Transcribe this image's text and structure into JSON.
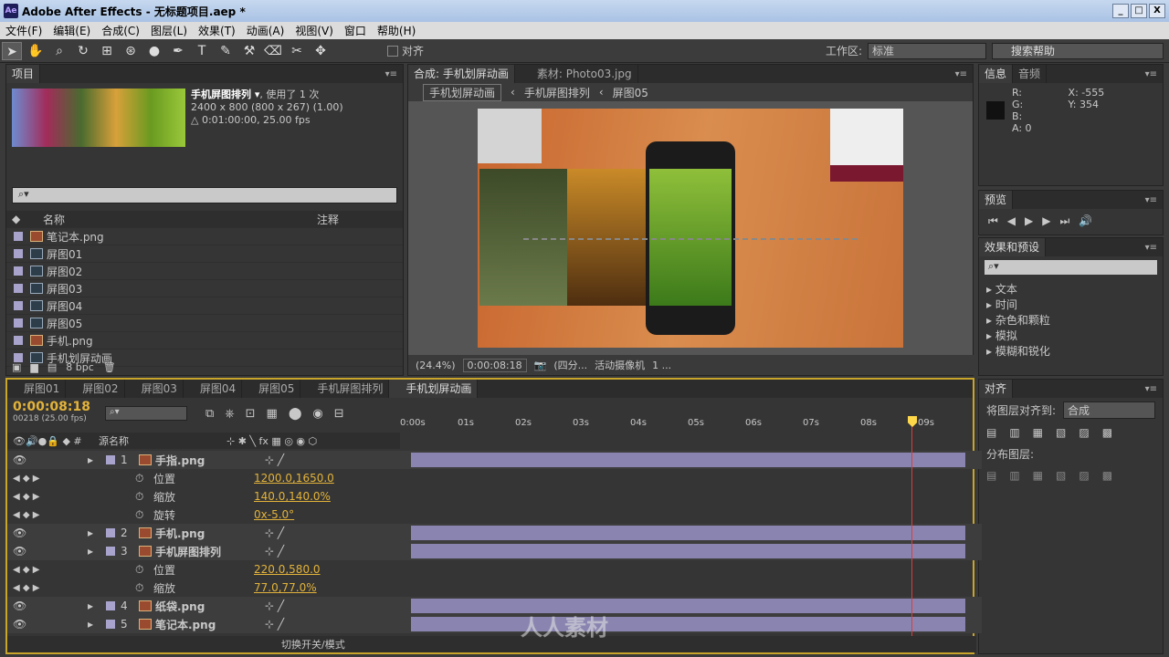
{
  "titlebar": {
    "title": "Adobe After Effects - 无标题项目.aep *",
    "min": "_",
    "max": "□",
    "close": "X"
  },
  "menu": [
    "文件(F)",
    "编辑(E)",
    "合成(C)",
    "图层(L)",
    "效果(T)",
    "动画(A)",
    "视图(V)",
    "窗口",
    "帮助(H)"
  ],
  "toolbar": {
    "align_label": "对齐",
    "workspace_label": "工作区:",
    "workspace_value": "标准",
    "search_placeholder": "搜索帮助"
  },
  "project": {
    "tab": "项目",
    "comp_name": "手机屏图排列 ▾",
    "used": ", 使用了 1 次",
    "dims": "2400 x 800  (800 x 267) (1.00)",
    "duration": "△ 0:01:00:00, 25.00 fps",
    "col_name": "名称",
    "col_note": "注释",
    "bpc": "8 bpc",
    "items": [
      {
        "name": "笔记本.png",
        "type": "file"
      },
      {
        "name": "屏图01",
        "type": "comp"
      },
      {
        "name": "屏图02",
        "type": "comp"
      },
      {
        "name": "屏图03",
        "type": "comp"
      },
      {
        "name": "屏图04",
        "type": "comp"
      },
      {
        "name": "屏图05",
        "type": "comp"
      },
      {
        "name": "手机.png",
        "type": "file"
      },
      {
        "name": "手机划屏动画",
        "type": "comp"
      }
    ]
  },
  "comp": {
    "tab": "合成: 手机划屏动画",
    "footage_tab": "素材: Photo03.jpg",
    "crumbs": [
      "手机划屏动画",
      "手机屏图排列",
      "屏图05"
    ],
    "zoom": "(24.4%)",
    "time": "0:00:08:18",
    "quality": "(四分...",
    "camera": "活动摄像机",
    "views": "1 ..."
  },
  "info": {
    "tab": "信息",
    "tab2": "音频",
    "r": "R:",
    "g": "G:",
    "b": "B:",
    "a": "A: 0",
    "x": "X: -555",
    "y": "Y: 354"
  },
  "preview": {
    "tab": "预览"
  },
  "effects": {
    "tab": "效果和预设",
    "items": [
      "▸ 文本",
      "▸ 时间",
      "▸ 杂色和颗粒",
      "▸ 模拟",
      "▸ 模糊和锐化"
    ]
  },
  "align": {
    "tab": "对齐",
    "align_to": "将图层对齐到:",
    "align_value": "合成",
    "distribute": "分布图层:"
  },
  "timeline": {
    "tabs": [
      "屏图01",
      "屏图02",
      "屏图03",
      "屏图04",
      "屏图05",
      "手机屏图排列",
      "手机划屏动画"
    ],
    "time": "0:00:08:18",
    "frames": "00218 (25.00 fps)",
    "col_source": "源名称",
    "ruler": [
      "0:00s",
      "01s",
      "02s",
      "03s",
      "04s",
      "05s",
      "06s",
      "07s",
      "08s",
      "09s"
    ],
    "rows": [
      {
        "kind": "layer",
        "num": "1",
        "name": "手指.png"
      },
      {
        "kind": "prop",
        "name": "位置",
        "value": "1200.0,1650.0"
      },
      {
        "kind": "prop",
        "name": "缩放",
        "value": "140.0,140.0%"
      },
      {
        "kind": "prop",
        "name": "旋转",
        "value": "0x-5.0°"
      },
      {
        "kind": "layer",
        "num": "2",
        "name": "手机.png"
      },
      {
        "kind": "layer",
        "num": "3",
        "name": "手机屏图排列"
      },
      {
        "kind": "prop",
        "name": "位置",
        "value": "220.0,580.0"
      },
      {
        "kind": "prop",
        "name": "缩放",
        "value": "77.0,77.0%"
      },
      {
        "kind": "layer",
        "num": "4",
        "name": "纸袋.png"
      },
      {
        "kind": "layer",
        "num": "5",
        "name": "笔记本.png"
      }
    ],
    "switch_label": "切换开关/模式"
  },
  "watermark": "人人素材"
}
